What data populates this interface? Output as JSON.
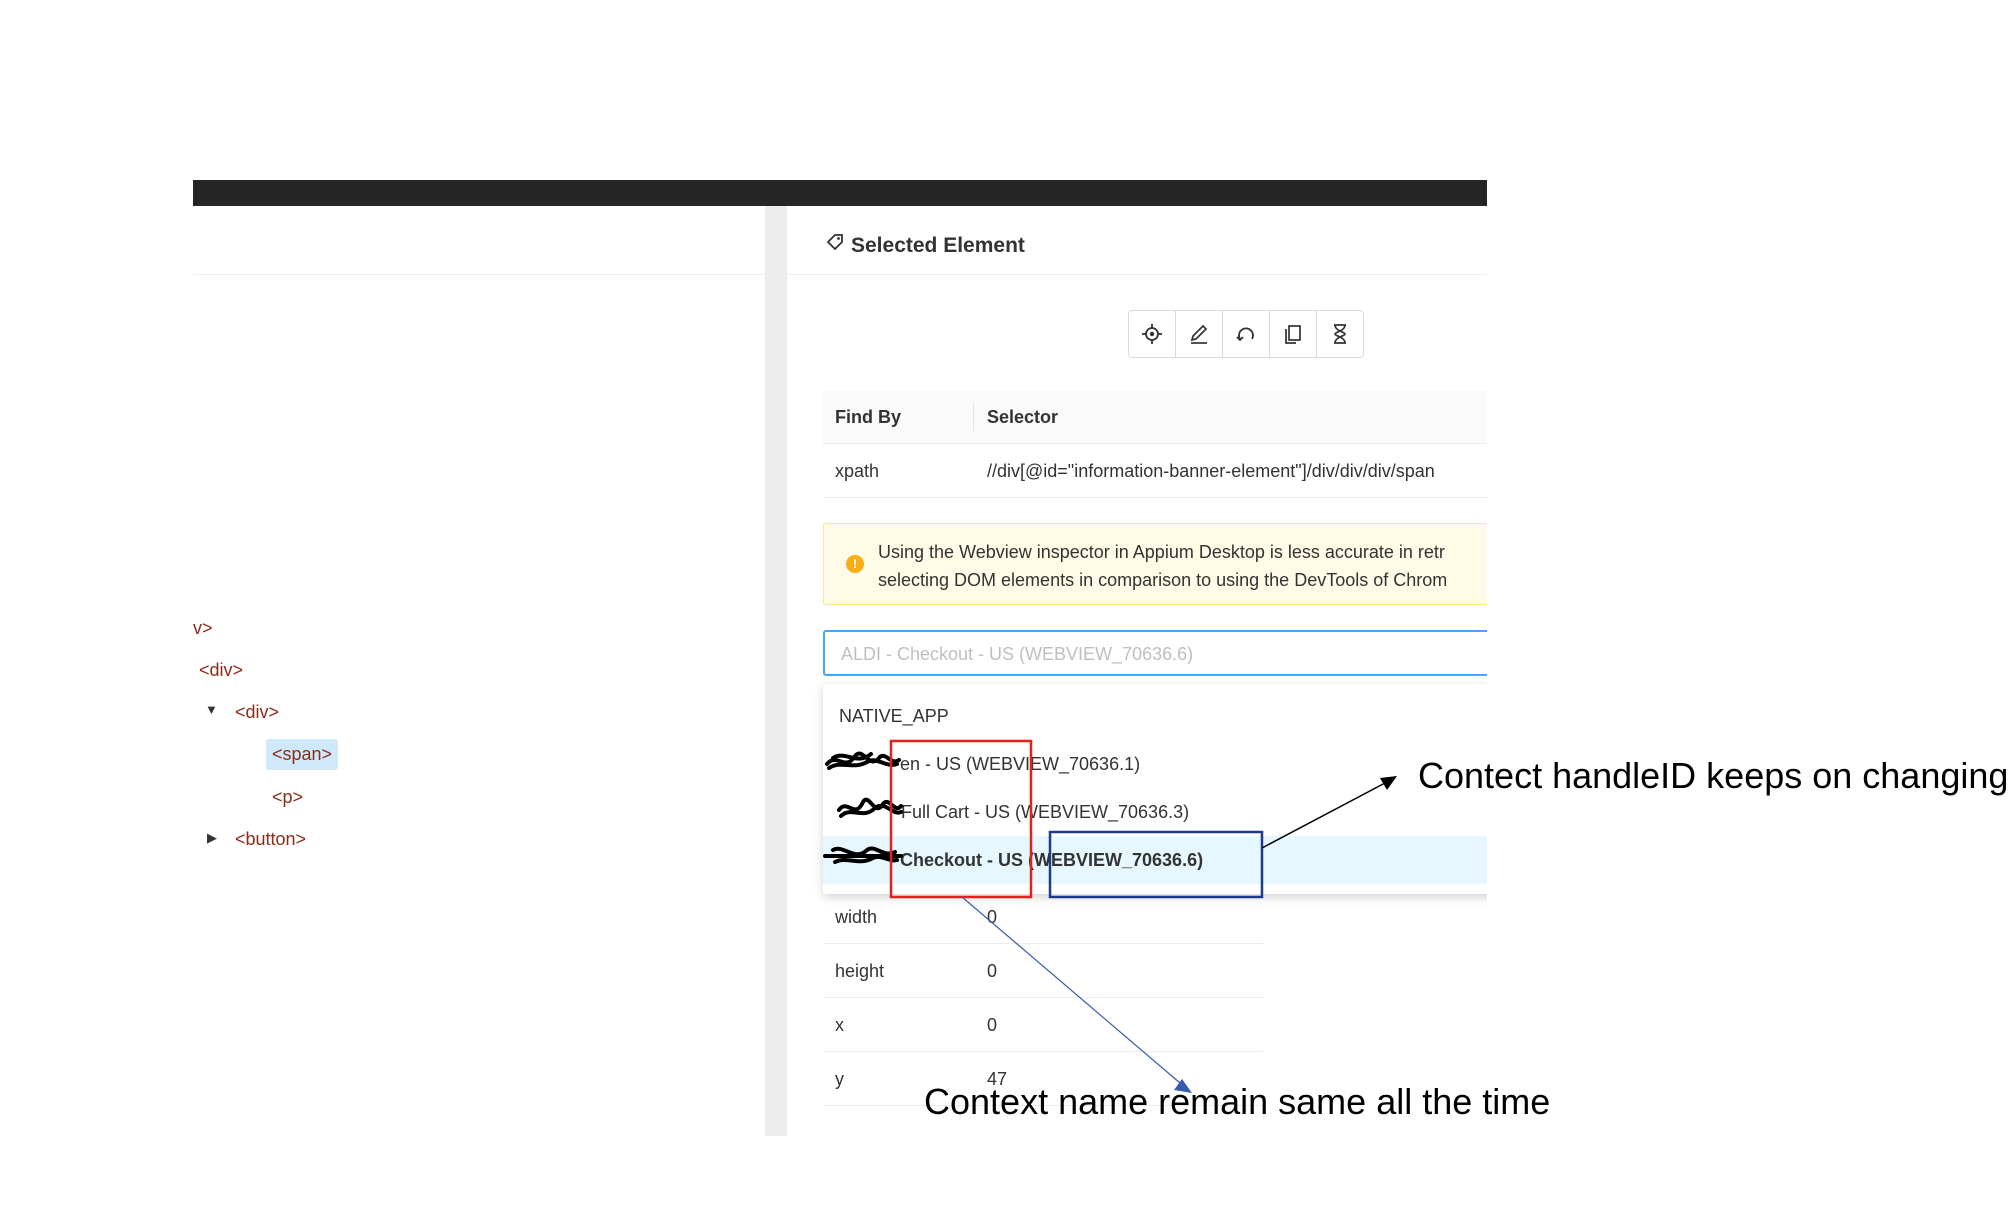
{
  "tree": {
    "nodes": [
      "v>",
      "<div>",
      "<div>",
      "<span>",
      "<p>",
      "<button>"
    ]
  },
  "panel": {
    "title": "Selected Element",
    "toolbar_icons": [
      "tap-target-icon",
      "edit-icon",
      "refresh-icon",
      "copy-icon",
      "hourglass-icon"
    ]
  },
  "selector_table": {
    "headers": [
      "Find By",
      "Selector"
    ],
    "rows": [
      {
        "find_by": "xpath",
        "selector": "//div[@id=\"information-banner-element\"]/div/div/div/span"
      }
    ]
  },
  "alert": {
    "line1": "Using the Webview inspector in Appium Desktop is less accurate in retr",
    "line2": "selecting DOM elements in comparison to using the DevTools of Chrom"
  },
  "context_select": {
    "placeholder": "ALDI - Checkout - US (WEBVIEW_70636.6)",
    "options": [
      "NATIVE_APP",
      "- en - US (WEBVIEW_70636.1)",
      "Full Cart - US (WEBVIEW_70636.3)",
      "- Checkout - US (WEBVIEW_70636.6)"
    ],
    "active_index": 3
  },
  "attributes": [
    {
      "name": "width",
      "value": "0"
    },
    {
      "name": "height",
      "value": "0"
    },
    {
      "name": "x",
      "value": "0"
    },
    {
      "name": "y",
      "value": "47"
    }
  ],
  "annotations": {
    "handle_note": "Contect handleID keeps on changing",
    "name_note": "Context name remain same all the time",
    "red_box_color": "#e0231c",
    "blue_box_color": "#1f3a8a"
  }
}
